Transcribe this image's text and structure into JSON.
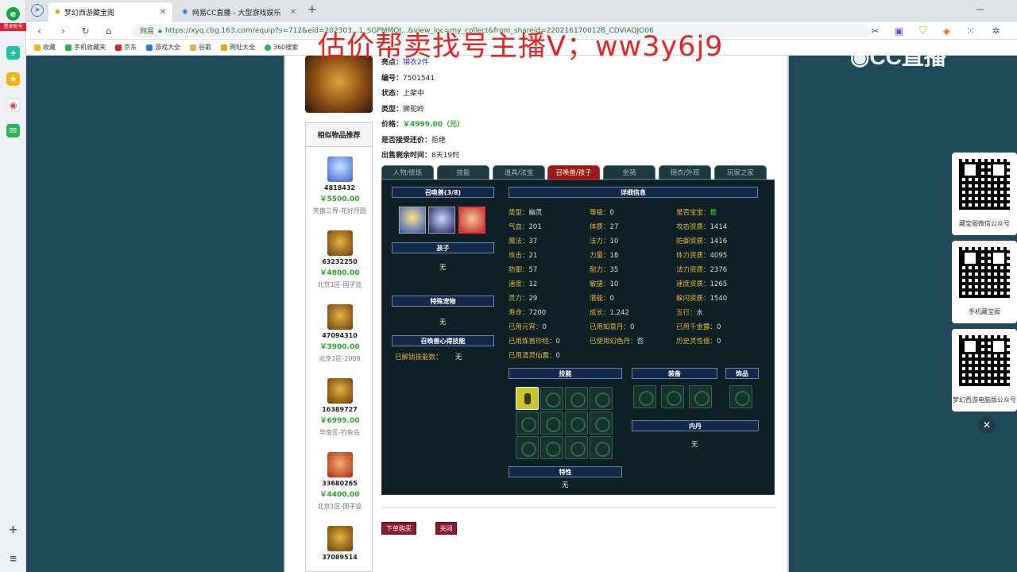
{
  "sidebar": {
    "login_label": "登录账号"
  },
  "tabs": [
    {
      "label": "梦幻西游藏宝阁"
    },
    {
      "label": "网易CC直播 - 大型游戏娱乐直播"
    }
  ],
  "address": {
    "site_badge": "网易",
    "url": "https://xyq.cbg.163.com/equip?s=712&eid=202303...1_SGPMMOJ...&view_loc=my_collect&from_shareid=2202161700128_CDVIAQJO06"
  },
  "bookmarks": [
    "收藏",
    "手机收藏夹",
    "京东",
    "游戏大全",
    "谷歌",
    "网址大全",
    "360搜索"
  ],
  "overlay": {
    "text": "估价帮卖找号主播V；ww3y6j9",
    "cc_logo": "CC直播"
  },
  "item_info": {
    "highlight_label": "亮点：",
    "highlight_value": "锦衣2件",
    "id_label": "编号：",
    "id_value": "7501541",
    "status_label": "状态：",
    "status_value": "上架中",
    "type_label": "类型：",
    "type_value": "狮驼岭",
    "price_label": "价格：",
    "price_value": "￥4999.00（元）",
    "bargain_label": "是否接受还价：",
    "bargain_value": "拒绝",
    "remaining_label": "出售剩余时间：",
    "remaining_value": "8天19时"
  },
  "recommend": {
    "title": "相似物品推荐",
    "items": [
      {
        "id": "4818432",
        "price": "￥5500.00",
        "server": "笑傲三界-花好月圆"
      },
      {
        "id": "63232250",
        "price": "￥4800.00",
        "server": "北京1区-国子监"
      },
      {
        "id": "47094310",
        "price": "￥3900.00",
        "server": "北京1区-2008"
      },
      {
        "id": "16389727",
        "price": "￥6999.00",
        "server": "华南区-钓鱼岛"
      },
      {
        "id": "33680265",
        "price": "￥4400.00",
        "server": "北京1区-国子监"
      },
      {
        "id": "37089514",
        "price": "",
        "server": ""
      }
    ]
  },
  "panel_tabs": [
    "人物/修炼",
    "技能",
    "道具/法宝",
    "召唤兽/孩子",
    "坐骑",
    "锦衣/外观",
    "玩家之家"
  ],
  "panel": {
    "summon_header": "召唤兽(3/8)",
    "child_header": "孩子",
    "child_value": "无",
    "special_header": "特殊宠物",
    "special_value": "无",
    "heart_header": "召唤兽心得技能",
    "unlocked_label": "已解锁技能数：",
    "unlocked_value": "无",
    "detail_header": "详细信息",
    "skills_header": "技能",
    "equip_header": "装备",
    "ornament_header": "饰品",
    "neidan_header": "内丹",
    "neidan_value": "无",
    "trait_header": "特性",
    "trait_value": "无"
  },
  "attrs": [
    {
      "k": "类型：",
      "v": "幽灵"
    },
    {
      "k": "等级：",
      "v": "0"
    },
    {
      "k": "是否宝宝：",
      "v": "是"
    },
    {
      "k": "气血：",
      "v": "201"
    },
    {
      "k": "体质：",
      "v": "27"
    },
    {
      "k": "攻击资质：",
      "v": "1414"
    },
    {
      "k": "魔法：",
      "v": "37"
    },
    {
      "k": "法力：",
      "v": "10"
    },
    {
      "k": "防御资质：",
      "v": "1416"
    },
    {
      "k": "攻击：",
      "v": "21"
    },
    {
      "k": "力量：",
      "v": "18"
    },
    {
      "k": "体力资质：",
      "v": "4095"
    },
    {
      "k": "防御：",
      "v": "57"
    },
    {
      "k": "耐力：",
      "v": "35"
    },
    {
      "k": "法力资质：",
      "v": "2376"
    },
    {
      "k": "速度：",
      "v": "12"
    },
    {
      "k": "敏捷：",
      "v": "10"
    },
    {
      "k": "速度资质：",
      "v": "1265"
    },
    {
      "k": "灵力：",
      "v": "29"
    },
    {
      "k": "潜能：",
      "v": "0"
    },
    {
      "k": "躲闪资质：",
      "v": "1540"
    },
    {
      "k": "寿命：",
      "v": "7200"
    },
    {
      "k": "成长：",
      "v": "1.242"
    },
    {
      "k": "五行：",
      "v": "水"
    },
    {
      "k": "已用元宵：",
      "v": "0"
    },
    {
      "k": "已用如意丹：",
      "v": "0"
    },
    {
      "k": "已用千金露：",
      "v": "0"
    },
    {
      "k": "已用炼兽珍经：",
      "v": "0"
    },
    {
      "k": "已使用幻色丹：",
      "v": "否"
    },
    {
      "k": "历史灵性值：",
      "v": "0"
    },
    {
      "k": "已用清灵仙露：",
      "v": "0"
    }
  ],
  "buttons": {
    "buy": "下单购买",
    "close": "关闭"
  },
  "ads": [
    {
      "label": "藏宝阁微信公众号"
    },
    {
      "label": "手机藏宝阁"
    },
    {
      "label": "梦幻西游电脑版公众号"
    }
  ]
}
